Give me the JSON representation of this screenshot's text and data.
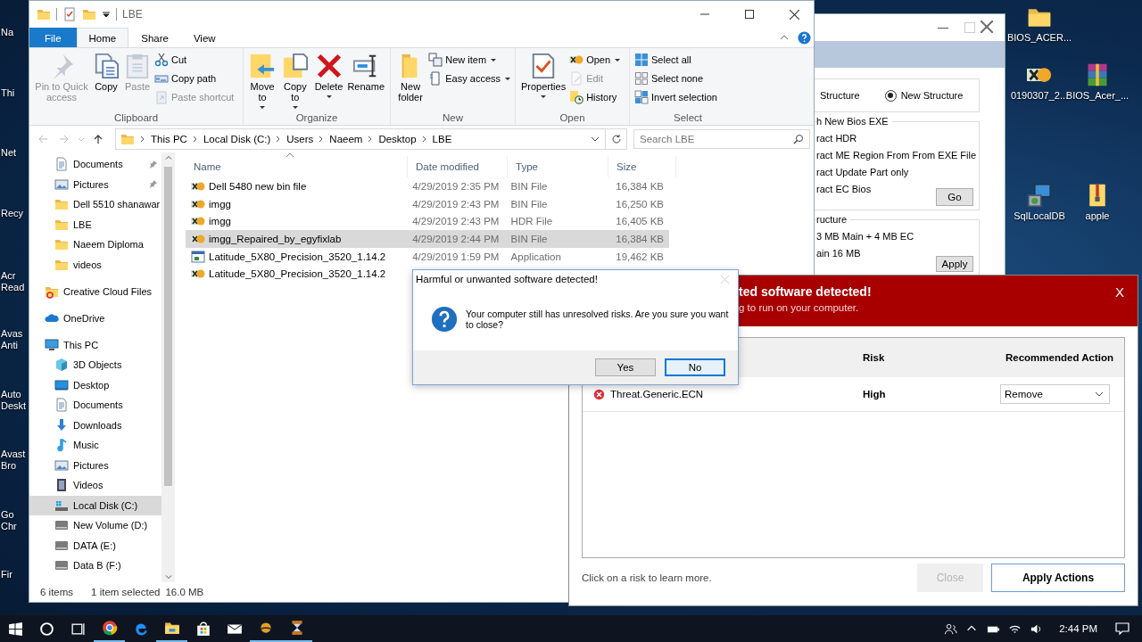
{
  "desktop": {
    "left_labels": [
      "Na",
      "Thi",
      "Net",
      "Recy",
      "Acr Read",
      "Avas Anti",
      "Auto Deskt",
      "Avast Bro",
      "Go Chr",
      "Fir"
    ],
    "right_icons": [
      {
        "label": "BIOS_ACER...",
        "kind": "folder"
      },
      {
        "label": "0190307_2...",
        "kind": "hex"
      },
      {
        "label": "BIOS_Acer_...",
        "kind": "archive"
      },
      {
        "label": "SqlLocalDB",
        "kind": "setup"
      },
      {
        "label": "apple",
        "kind": "zip"
      }
    ]
  },
  "explorer": {
    "title": "LBE",
    "tabs": [
      {
        "label": "File",
        "kind": "menu",
        "selected": false
      },
      {
        "label": "Home",
        "kind": "tab",
        "selected": true
      },
      {
        "label": "Share",
        "kind": "tab",
        "selected": false
      },
      {
        "label": "View",
        "kind": "tab",
        "selected": false
      }
    ],
    "ribbon": [
      {
        "label": "Clipboard",
        "large": [
          {
            "label": "Pin to Quick access",
            "disabled": true,
            "menu": false
          },
          {
            "label": "Copy",
            "disabled": false,
            "menu": false
          },
          {
            "label": "Paste",
            "disabled": true,
            "menu": false
          }
        ],
        "small": [
          {
            "label": "Cut",
            "disabled": false,
            "menu": false
          },
          {
            "label": "Copy path",
            "disabled": false,
            "menu": false
          },
          {
            "label": "Paste shortcut",
            "disabled": true,
            "menu": false
          }
        ]
      },
      {
        "label": "Organize",
        "large": [
          {
            "label": "Move to",
            "disabled": false,
            "menu": true
          },
          {
            "label": "Copy to",
            "disabled": false,
            "menu": true
          },
          {
            "label": "Delete",
            "disabled": false,
            "menu": true
          },
          {
            "label": "Rename",
            "disabled": false,
            "menu": false
          }
        ]
      },
      {
        "label": "New",
        "large": [
          {
            "label": "New folder",
            "disabled": false,
            "menu": false
          }
        ],
        "small": [
          {
            "label": "New item",
            "disabled": false,
            "menu": true
          },
          {
            "label": "Easy access",
            "disabled": false,
            "menu": true
          }
        ]
      },
      {
        "label": "Open",
        "large": [
          {
            "label": "Properties",
            "disabled": false,
            "menu": true
          }
        ],
        "small": [
          {
            "label": "Open",
            "disabled": false,
            "menu": true
          },
          {
            "label": "Edit",
            "disabled": true,
            "menu": false
          },
          {
            "label": "History",
            "disabled": false,
            "menu": false
          }
        ]
      },
      {
        "label": "Select",
        "small": [
          {
            "label": "Select all",
            "disabled": false,
            "menu": false
          },
          {
            "label": "Select none",
            "disabled": false,
            "menu": false
          },
          {
            "label": "Invert selection",
            "disabled": false,
            "menu": false
          }
        ]
      }
    ],
    "path": [
      "This PC",
      "Local Disk (C:)",
      "Users",
      "Naeem",
      "Desktop",
      "LBE"
    ],
    "search": {
      "placeholder": "Search LBE"
    },
    "nav": {
      "quick_access": [
        {
          "label": "Documents",
          "kind": "documents",
          "pinned": true,
          "selected": false
        },
        {
          "label": "Pictures",
          "kind": "pictures",
          "pinned": true,
          "selected": false
        },
        {
          "label": "Dell 5510 shanawar",
          "kind": "folder",
          "pinned": false,
          "selected": false
        },
        {
          "label": "LBE",
          "kind": "folder",
          "pinned": false,
          "selected": false
        },
        {
          "label": "Naeem Diploma",
          "kind": "folder",
          "pinned": false,
          "selected": false
        },
        {
          "label": "videos",
          "kind": "folder",
          "pinned": false,
          "selected": false
        }
      ],
      "places": [
        {
          "label": "Creative Cloud Files",
          "kind": "cloudfolder",
          "selected": false
        },
        {
          "label": "OneDrive",
          "kind": "onedrive",
          "selected": false
        },
        {
          "label": "This PC",
          "kind": "pc",
          "selected": false,
          "children": [
            {
              "label": "3D Objects",
              "kind": "cube",
              "selected": false
            },
            {
              "label": "Desktop",
              "kind": "desktop",
              "selected": false
            },
            {
              "label": "Documents",
              "kind": "documents",
              "selected": false
            },
            {
              "label": "Downloads",
              "kind": "downloads",
              "selected": false
            },
            {
              "label": "Music",
              "kind": "music",
              "selected": false
            },
            {
              "label": "Pictures",
              "kind": "pictures",
              "selected": false
            },
            {
              "label": "Videos",
              "kind": "videos",
              "selected": false
            },
            {
              "label": "Local Disk (C:)",
              "kind": "systemdrive",
              "selected": true
            },
            {
              "label": "New Volume (D:)",
              "kind": "drive",
              "selected": false
            },
            {
              "label": "DATA (E:)",
              "kind": "drive",
              "selected": false
            },
            {
              "label": "Data B (F:)",
              "kind": "drive",
              "selected": false
            }
          ]
        }
      ]
    },
    "columns": [
      {
        "label": "Name",
        "sorted": true
      },
      {
        "label": "Date modified",
        "sorted": false
      },
      {
        "label": "Type",
        "sorted": false
      },
      {
        "label": "Size",
        "sorted": false
      }
    ],
    "files": [
      {
        "name": "Dell 5480 new bin file",
        "date": "4/29/2019 2:35 PM",
        "type": "BIN File",
        "size": "16,384 KB",
        "kind": "hex",
        "selected": false
      },
      {
        "name": "imgg",
        "date": "4/29/2019 2:43 PM",
        "type": "BIN File",
        "size": "16,250 KB",
        "kind": "hex",
        "selected": false
      },
      {
        "name": "imgg",
        "date": "4/29/2019 2:43 PM",
        "type": "HDR File",
        "size": "16,405 KB",
        "kind": "hex",
        "selected": false
      },
      {
        "name": "imgg_Repaired_by_egyfixlab",
        "date": "4/29/2019 2:44 PM",
        "type": "BIN File",
        "size": "16,384 KB",
        "kind": "hex",
        "selected": true
      },
      {
        "name": "Latitude_5X80_Precision_3520_1.14.2",
        "date": "4/29/2019 1:59 PM",
        "type": "Application",
        "size": "19,462 KB",
        "kind": "app",
        "selected": false
      },
      {
        "name": "Latitude_5X80_Precision_3520_1.14.2",
        "kind": "hex",
        "selected": false
      }
    ],
    "status": [
      "6 items",
      "1 item selected",
      "16.0 MB"
    ]
  },
  "bios_tool": {
    "structure_label": "Structure",
    "radio": {
      "label": "New Structure",
      "selected": true
    },
    "group1": {
      "legend": "h New Bios EXE",
      "options": [
        "ract HDR",
        "ract ME Region From  From EXE File",
        "ract Update Part only",
        "ract EC Bios"
      ],
      "button": "Go"
    },
    "group2": {
      "legend": "ructure",
      "options": [
        "3 MB Main + 4 MB EC",
        "ain 16 MB"
      ],
      "button": "Apply"
    }
  },
  "antivirus": {
    "title": "ted software detected!",
    "subtitle": "g to run on your computer.",
    "close": "X",
    "columns": [
      "Risk",
      "Recommended Action"
    ],
    "rows": [
      {
        "name": "Threat.Generic.ECN",
        "risk": "High",
        "action": "Remove"
      }
    ],
    "hint": "Click on a risk to learn more.",
    "buttons": [
      {
        "label": "Close",
        "disabled": true
      },
      {
        "label": "Apply Actions",
        "disabled": false
      }
    ]
  },
  "dialog": {
    "title": "Harmful or unwanted software detected!",
    "message": "Your computer still has unresolved risks. Are you sure you want to close?",
    "buttons": [
      {
        "label": "Yes",
        "selected": false
      },
      {
        "label": "No",
        "selected": true
      }
    ]
  },
  "taskbar": {
    "apps": [
      {
        "running": true
      },
      {
        "running": false
      },
      {
        "running": true
      },
      {
        "running": false
      },
      {
        "running": false
      },
      {
        "running": true
      },
      {
        "running": true
      }
    ],
    "time": "2:44 PM"
  }
}
